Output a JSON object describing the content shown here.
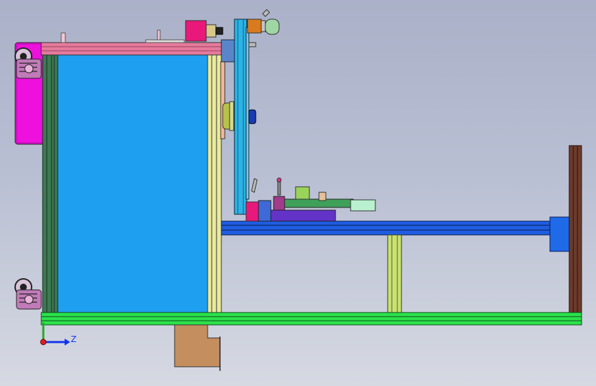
{
  "colors": {
    "background_top": "#aab1c8",
    "background_bottom": "#d6d9e2",
    "cabinet_panel": "#1e9ff0",
    "top_rail": "#e57b9c",
    "base_frame": "#2be24b",
    "magenta_block": "#ee11dd",
    "horizontal_beam": "#1f5de0",
    "vertical_column": "#2bb4e6",
    "support_leg": "#c9e26c",
    "end_post": "#6b3b2c",
    "bottom_bracket": "#c48e5f",
    "axis_x": "#22aa22",
    "axis_z": "#1133ee"
  },
  "icons": [
    "caster-wheel-icon",
    "axis-triad-icon"
  ],
  "axis": {
    "z_label": "Z"
  }
}
